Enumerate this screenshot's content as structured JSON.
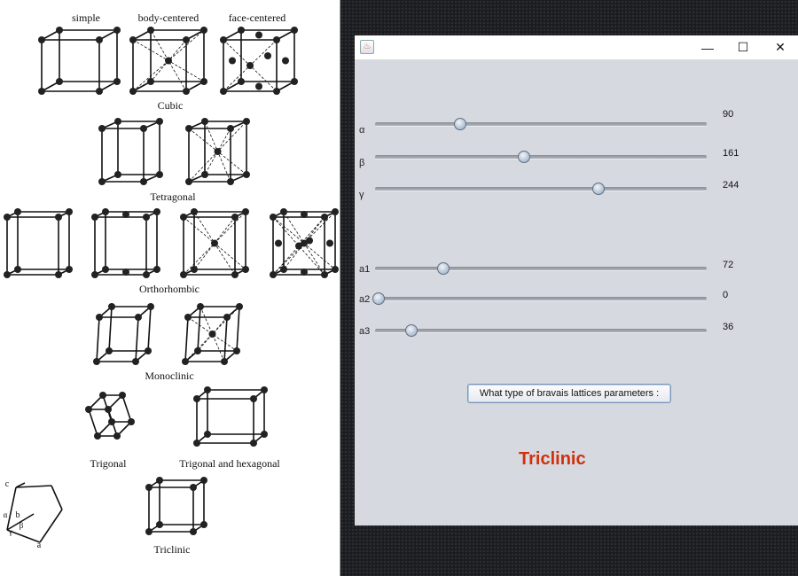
{
  "reference_image": {
    "labels": {
      "simple": "simple",
      "body_centered": "body-centered",
      "face_centered": "face-centered",
      "cubic": "Cubic",
      "tetragonal": "Tetragonal",
      "orthorhombic": "Orthorhombic",
      "monoclinic": "Monoclinic",
      "trigonal": "Trigonal",
      "trigonal_hexagonal": "Trigonal and hexagonal",
      "triclinic": "Triclinic"
    },
    "axis_labels": {
      "c": "c",
      "b": "b",
      "a": "a",
      "alpha": "α",
      "beta": "β",
      "gamma": "γ"
    }
  },
  "window": {
    "title_icon": "java-icon",
    "controls": {
      "minimize": "—",
      "maximize": "☐",
      "close": "✕"
    }
  },
  "sliders": [
    {
      "label": "α",
      "value": 90,
      "max": 360
    },
    {
      "label": "β",
      "value": 161,
      "max": 360
    },
    {
      "label": "γ",
      "value": 244,
      "max": 360
    },
    {
      "label": "a1",
      "value": 72,
      "max": 360
    },
    {
      "label": "a2",
      "value": 0,
      "max": 360
    },
    {
      "label": "a3",
      "value": 36,
      "max": 360
    }
  ],
  "button": {
    "label": "What type of bravais lattices parameters :"
  },
  "result": {
    "text": "Triclinic",
    "color": "#d0300c"
  }
}
